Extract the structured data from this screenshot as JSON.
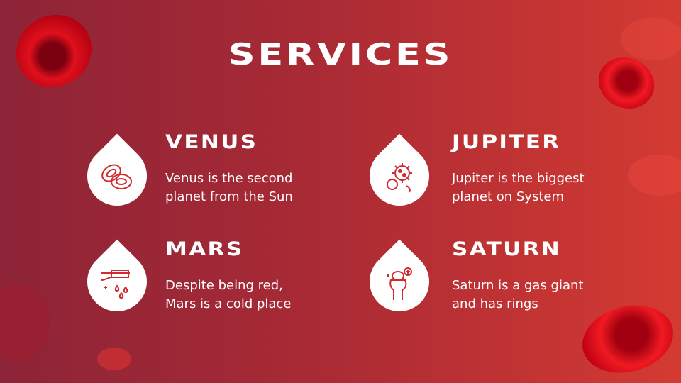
{
  "title": "SERVICES",
  "services": [
    {
      "heading": "VENUS",
      "line1": "Venus is the second",
      "line2": "planet from the Sun",
      "icon": "red-blood-cells-icon"
    },
    {
      "heading": "JUPITER",
      "line1": "Jupiter is the biggest",
      "line2": "planet on System",
      "icon": "virus-bacteria-icon"
    },
    {
      "heading": "MARS",
      "line1": "Despite being red,",
      "line2": "Mars is a cold place",
      "icon": "blood-test-icon"
    },
    {
      "heading": "SATURN",
      "line1": "Saturn is a gas giant",
      "line2": "and has rings",
      "icon": "hand-blood-cell-icon"
    }
  ],
  "colors": {
    "accent": "#d12b2e",
    "bg_left": "#8d2437",
    "bg_right": "#d43a32"
  }
}
